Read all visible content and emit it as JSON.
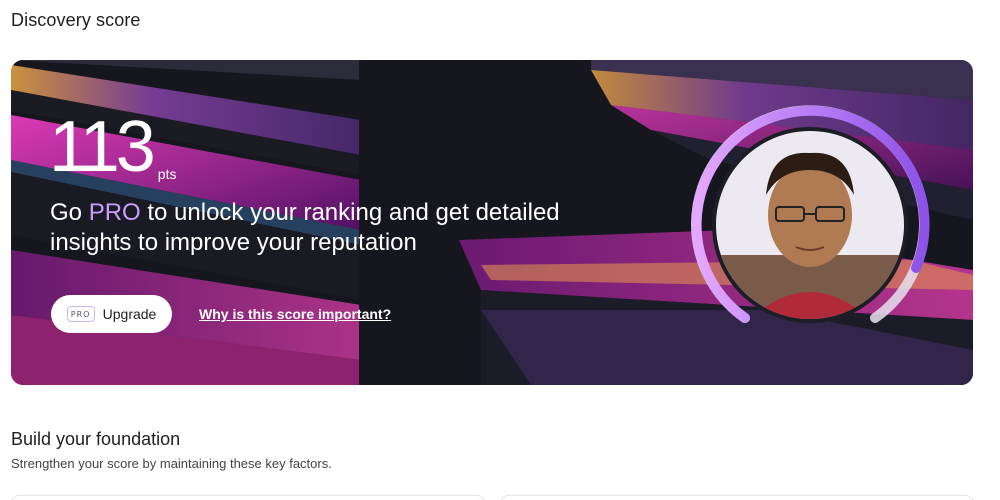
{
  "section": {
    "title": "Discovery score"
  },
  "hero": {
    "score": "113",
    "unit": "pts",
    "cta_prefix": "Go ",
    "cta_pro": "PRO",
    "cta_suffix": " to unlock your ranking and get detailed insights to improve your reputation",
    "upgrade_badge": "PRO",
    "upgrade_label": "Upgrade",
    "why_link": "Why is this score important?",
    "ring_progress": 0.78,
    "ring_color_start": "#e0a0ff",
    "ring_color_end": "#8a55e6",
    "avatar": "profile-photo"
  },
  "foundation": {
    "title": "Build your foundation",
    "subtitle": "Strengthen your score by maintaining these key factors."
  }
}
